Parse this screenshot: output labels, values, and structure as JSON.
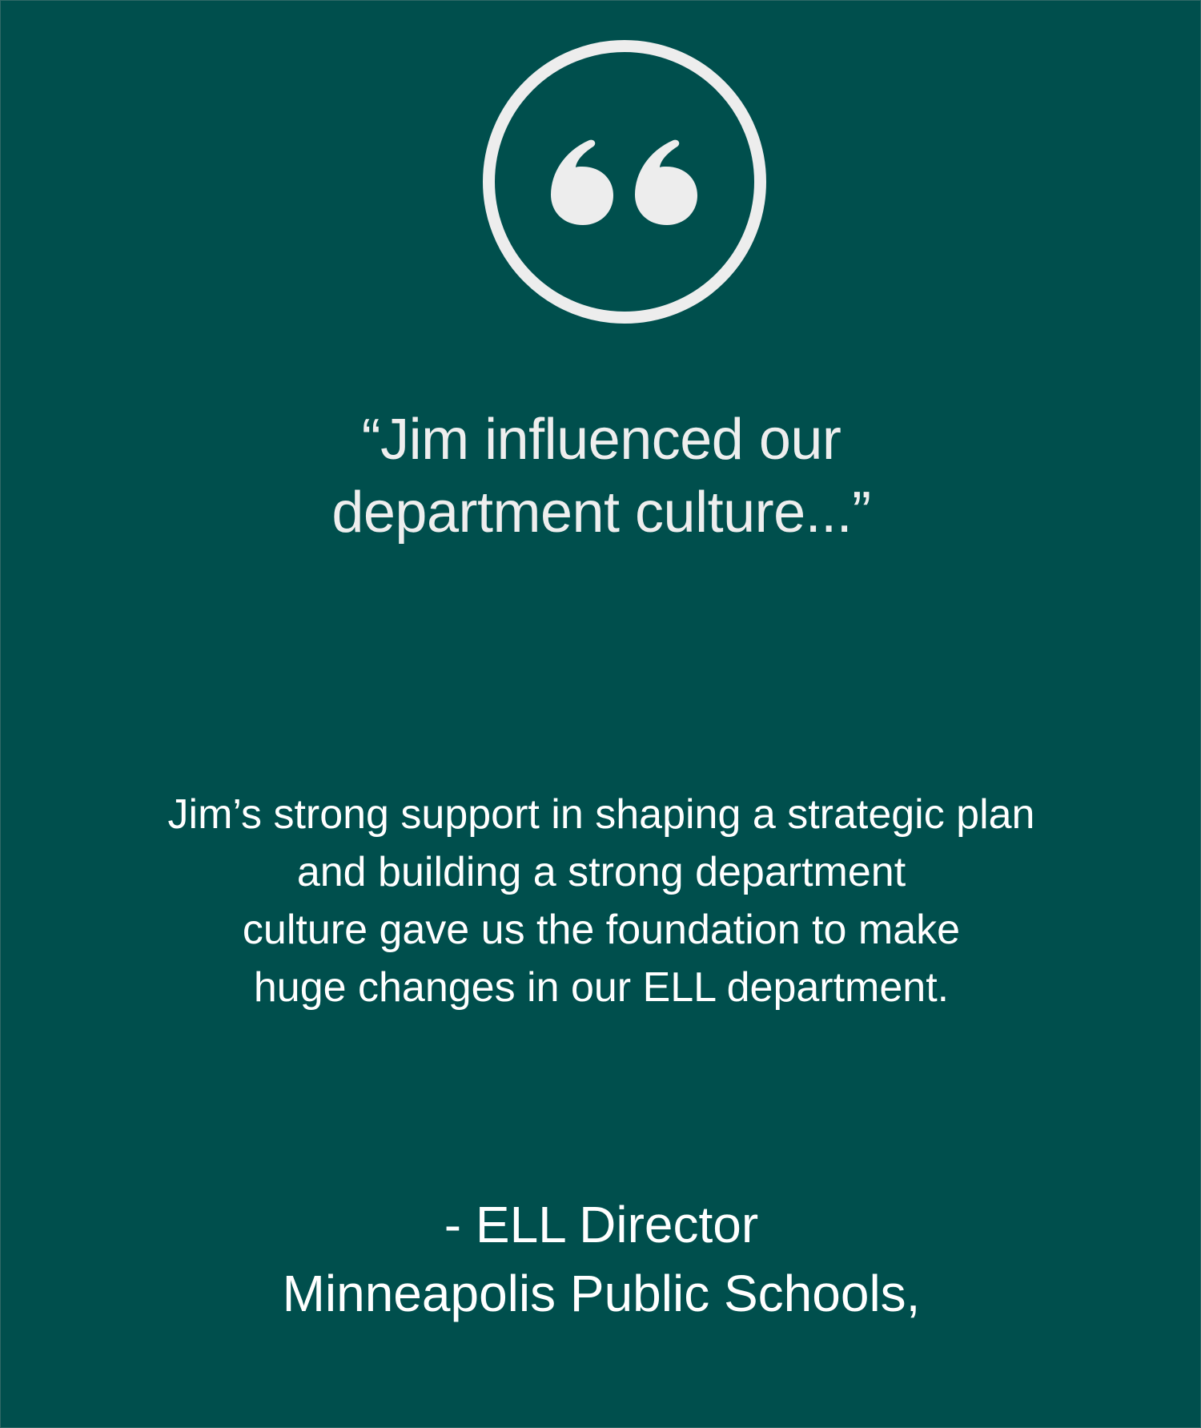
{
  "badge": {
    "icon": "quote-icon"
  },
  "headline": {
    "line1": "“Jim influenced our",
    "line2": "department culture...”"
  },
  "body": {
    "lines": [
      "Jim’s strong support in shaping a strategic plan",
      "and building a strong department",
      "culture gave us the foundation to make",
      "huge changes in our ELL department."
    ]
  },
  "attribution": {
    "role": "- ELL Director",
    "organization": "Minneapolis Public Schools,"
  },
  "colors": {
    "background": "#004f4d",
    "foreground": "#ededed"
  }
}
